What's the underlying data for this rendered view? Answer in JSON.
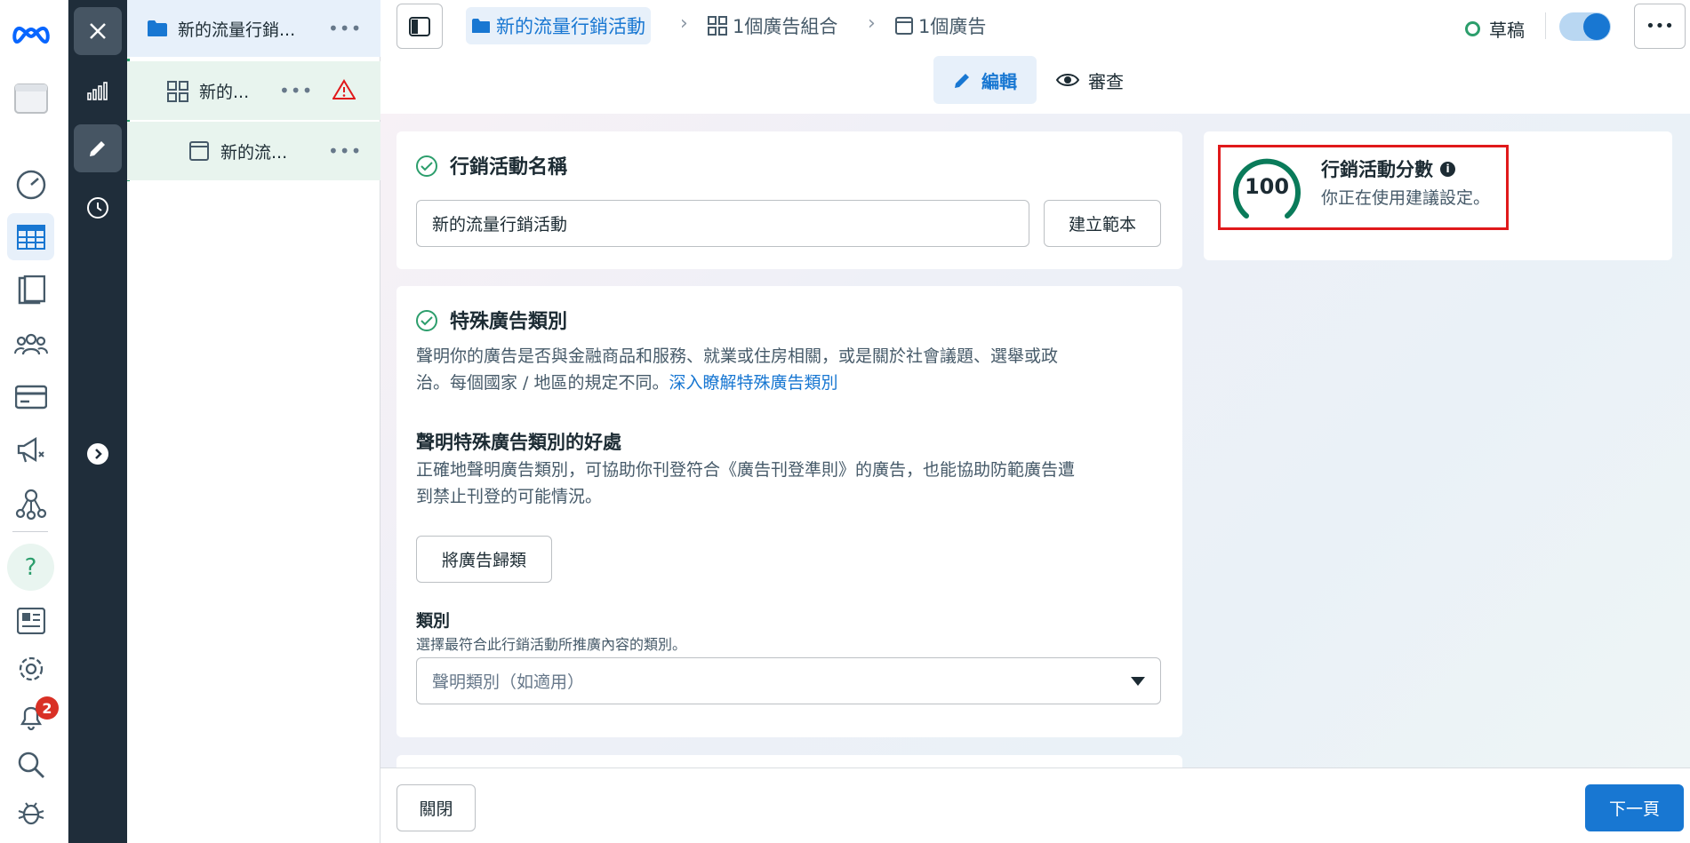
{
  "rail": {
    "items": [
      "meta-logo",
      "ads-manager-icon",
      "dashboard-icon",
      "table-icon",
      "pages-icon",
      "audiences-icon",
      "billing-icon",
      "campaign-icon",
      "network-icon",
      "help-icon",
      "news-icon",
      "settings-icon",
      "bell-icon",
      "search-icon",
      "bug-icon"
    ],
    "notification_count": "2"
  },
  "tree": {
    "campaign_label": "新的流量行銷...",
    "adset_label": "新的...",
    "ad_label": "新的流...",
    "more": "•••"
  },
  "breadcrumb": {
    "campaign": "新的流量行銷活動",
    "adset": "1個廣告組合",
    "ad": "1個廣告"
  },
  "status": {
    "label": "草稿"
  },
  "tabs": {
    "edit": "編輯",
    "review": "審查"
  },
  "campaign_name": {
    "title": "行銷活動名稱",
    "value": "新的流量行銷活動",
    "template_button": "建立範本"
  },
  "special_category": {
    "title": "特殊廣告類別",
    "desc_line1": "聲明你的廣告是否與金融商品和服務、就業或住房相關，或是關於社會議題、選舉或政",
    "desc_line2": "治。每個國家 / 地區的規定不同。",
    "learn_more": "深入瞭解特殊廣告類別",
    "benefit_title": "聲明特殊廣告類別的好處",
    "benefit_line1": "正確地聲明廣告類別，可協助你刊登符合《廣告刊登準則》的廣告，也能協助防範廣告遭",
    "benefit_line2": "到禁止刊登的可能情況。",
    "classify_button": "將廣告歸類",
    "category_label": "類別",
    "category_hint": "選擇最符合此行銷活動所推廣內容的類別。",
    "category_placeholder": "聲明類別（如適用）"
  },
  "score": {
    "value": "100",
    "title": "行銷活動分數",
    "subtitle": "你正在使用建議設定。"
  },
  "footer": {
    "close": "關閉",
    "next": "下一頁"
  },
  "colors": {
    "accent": "#1877d2",
    "green": "#2c9e6c",
    "highlight_border": "#e0191b"
  }
}
